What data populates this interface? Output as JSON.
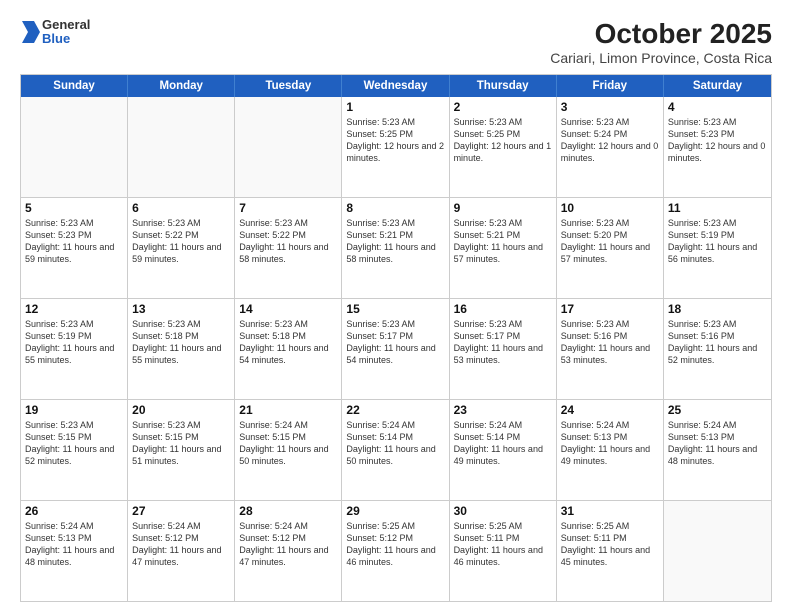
{
  "logo": {
    "general": "General",
    "blue": "Blue"
  },
  "title": "October 2025",
  "subtitle": "Cariari, Limon Province, Costa Rica",
  "weekdays": [
    "Sunday",
    "Monday",
    "Tuesday",
    "Wednesday",
    "Thursday",
    "Friday",
    "Saturday"
  ],
  "rows": [
    [
      {
        "day": "",
        "info": ""
      },
      {
        "day": "",
        "info": ""
      },
      {
        "day": "",
        "info": ""
      },
      {
        "day": "1",
        "info": "Sunrise: 5:23 AM\nSunset: 5:25 PM\nDaylight: 12 hours\nand 2 minutes."
      },
      {
        "day": "2",
        "info": "Sunrise: 5:23 AM\nSunset: 5:25 PM\nDaylight: 12 hours\nand 1 minute."
      },
      {
        "day": "3",
        "info": "Sunrise: 5:23 AM\nSunset: 5:24 PM\nDaylight: 12 hours\nand 0 minutes."
      },
      {
        "day": "4",
        "info": "Sunrise: 5:23 AM\nSunset: 5:23 PM\nDaylight: 12 hours\nand 0 minutes."
      }
    ],
    [
      {
        "day": "5",
        "info": "Sunrise: 5:23 AM\nSunset: 5:23 PM\nDaylight: 11 hours\nand 59 minutes."
      },
      {
        "day": "6",
        "info": "Sunrise: 5:23 AM\nSunset: 5:22 PM\nDaylight: 11 hours\nand 59 minutes."
      },
      {
        "day": "7",
        "info": "Sunrise: 5:23 AM\nSunset: 5:22 PM\nDaylight: 11 hours\nand 58 minutes."
      },
      {
        "day": "8",
        "info": "Sunrise: 5:23 AM\nSunset: 5:21 PM\nDaylight: 11 hours\nand 58 minutes."
      },
      {
        "day": "9",
        "info": "Sunrise: 5:23 AM\nSunset: 5:21 PM\nDaylight: 11 hours\nand 57 minutes."
      },
      {
        "day": "10",
        "info": "Sunrise: 5:23 AM\nSunset: 5:20 PM\nDaylight: 11 hours\nand 57 minutes."
      },
      {
        "day": "11",
        "info": "Sunrise: 5:23 AM\nSunset: 5:19 PM\nDaylight: 11 hours\nand 56 minutes."
      }
    ],
    [
      {
        "day": "12",
        "info": "Sunrise: 5:23 AM\nSunset: 5:19 PM\nDaylight: 11 hours\nand 55 minutes."
      },
      {
        "day": "13",
        "info": "Sunrise: 5:23 AM\nSunset: 5:18 PM\nDaylight: 11 hours\nand 55 minutes."
      },
      {
        "day": "14",
        "info": "Sunrise: 5:23 AM\nSunset: 5:18 PM\nDaylight: 11 hours\nand 54 minutes."
      },
      {
        "day": "15",
        "info": "Sunrise: 5:23 AM\nSunset: 5:17 PM\nDaylight: 11 hours\nand 54 minutes."
      },
      {
        "day": "16",
        "info": "Sunrise: 5:23 AM\nSunset: 5:17 PM\nDaylight: 11 hours\nand 53 minutes."
      },
      {
        "day": "17",
        "info": "Sunrise: 5:23 AM\nSunset: 5:16 PM\nDaylight: 11 hours\nand 53 minutes."
      },
      {
        "day": "18",
        "info": "Sunrise: 5:23 AM\nSunset: 5:16 PM\nDaylight: 11 hours\nand 52 minutes."
      }
    ],
    [
      {
        "day": "19",
        "info": "Sunrise: 5:23 AM\nSunset: 5:15 PM\nDaylight: 11 hours\nand 52 minutes."
      },
      {
        "day": "20",
        "info": "Sunrise: 5:23 AM\nSunset: 5:15 PM\nDaylight: 11 hours\nand 51 minutes."
      },
      {
        "day": "21",
        "info": "Sunrise: 5:24 AM\nSunset: 5:15 PM\nDaylight: 11 hours\nand 50 minutes."
      },
      {
        "day": "22",
        "info": "Sunrise: 5:24 AM\nSunset: 5:14 PM\nDaylight: 11 hours\nand 50 minutes."
      },
      {
        "day": "23",
        "info": "Sunrise: 5:24 AM\nSunset: 5:14 PM\nDaylight: 11 hours\nand 49 minutes."
      },
      {
        "day": "24",
        "info": "Sunrise: 5:24 AM\nSunset: 5:13 PM\nDaylight: 11 hours\nand 49 minutes."
      },
      {
        "day": "25",
        "info": "Sunrise: 5:24 AM\nSunset: 5:13 PM\nDaylight: 11 hours\nand 48 minutes."
      }
    ],
    [
      {
        "day": "26",
        "info": "Sunrise: 5:24 AM\nSunset: 5:13 PM\nDaylight: 11 hours\nand 48 minutes."
      },
      {
        "day": "27",
        "info": "Sunrise: 5:24 AM\nSunset: 5:12 PM\nDaylight: 11 hours\nand 47 minutes."
      },
      {
        "day": "28",
        "info": "Sunrise: 5:24 AM\nSunset: 5:12 PM\nDaylight: 11 hours\nand 47 minutes."
      },
      {
        "day": "29",
        "info": "Sunrise: 5:25 AM\nSunset: 5:12 PM\nDaylight: 11 hours\nand 46 minutes."
      },
      {
        "day": "30",
        "info": "Sunrise: 5:25 AM\nSunset: 5:11 PM\nDaylight: 11 hours\nand 46 minutes."
      },
      {
        "day": "31",
        "info": "Sunrise: 5:25 AM\nSunset: 5:11 PM\nDaylight: 11 hours\nand 45 minutes."
      },
      {
        "day": "",
        "info": ""
      }
    ]
  ]
}
